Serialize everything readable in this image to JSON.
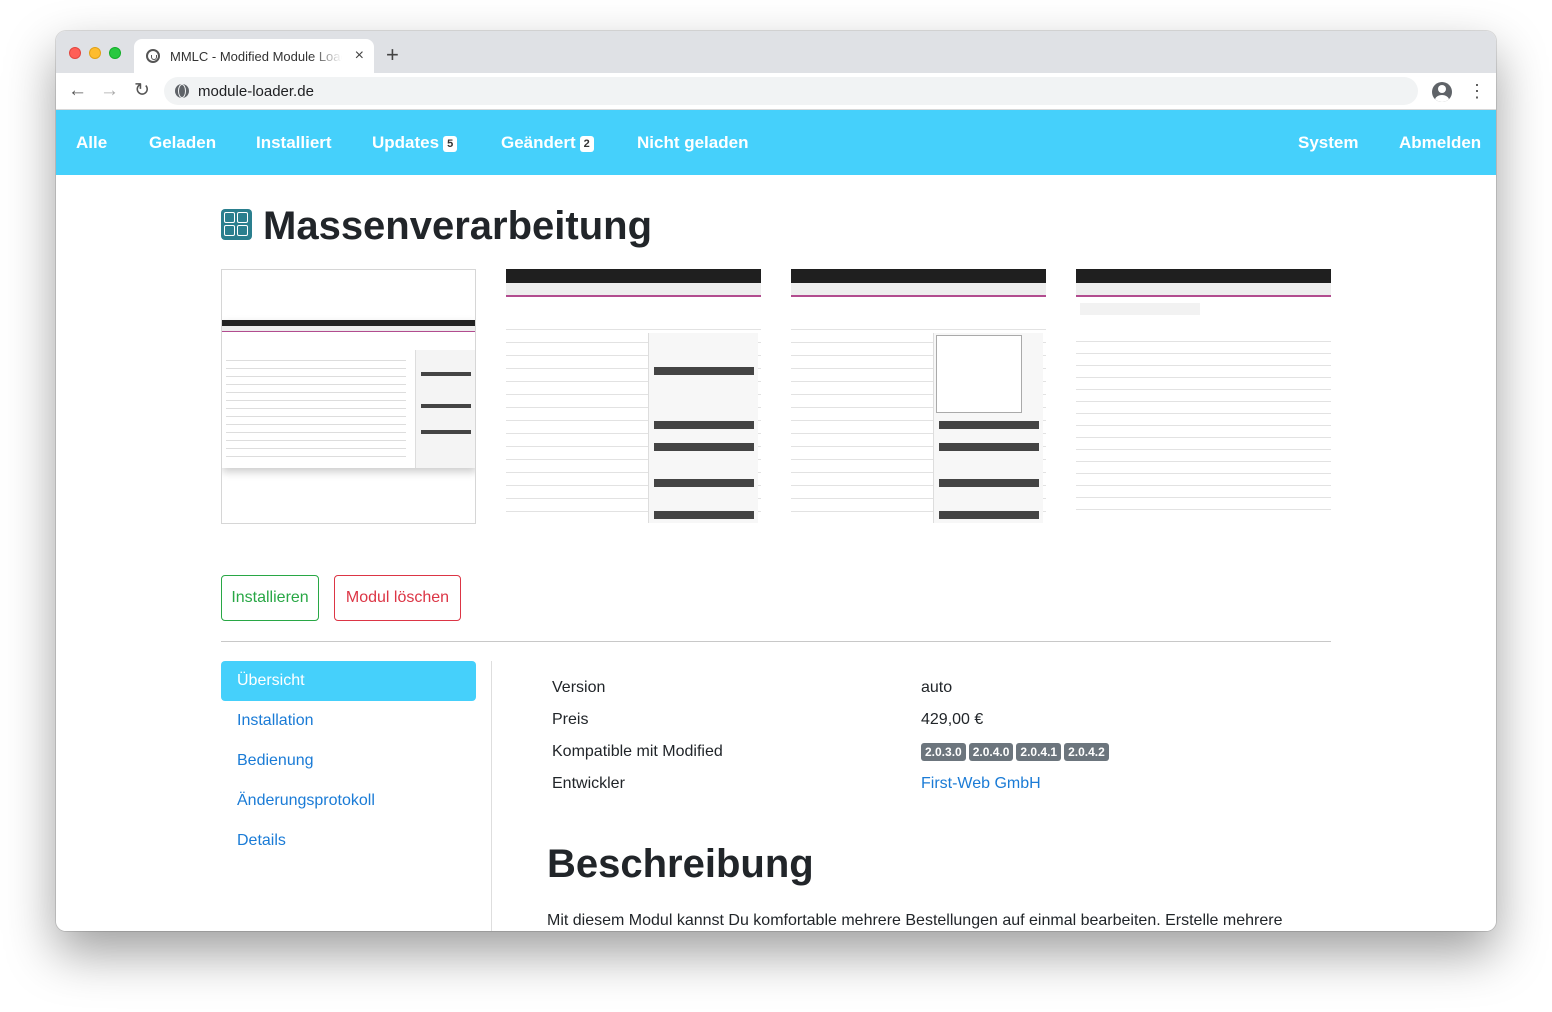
{
  "browser": {
    "tab_title": "MMLC - Modified Module Loader",
    "tab_close": "×",
    "new_tab": "+",
    "back": "←",
    "forward": "→",
    "reload": "↻",
    "url": "module-loader.de",
    "menu": "⋮"
  },
  "nav": {
    "items": [
      {
        "label": "Alle",
        "badge": ""
      },
      {
        "label": "Geladen",
        "badge": ""
      },
      {
        "label": "Installiert",
        "badge": ""
      },
      {
        "label": "Updates",
        "badge": "5"
      },
      {
        "label": "Geändert",
        "badge": "2"
      },
      {
        "label": "Nicht geladen",
        "badge": ""
      }
    ],
    "right": [
      {
        "label": "System"
      },
      {
        "label": "Abmelden"
      }
    ]
  },
  "module": {
    "title": "Massenverarbeitung",
    "icon": "checklist-icon",
    "screenshots": [
      {
        "name": "screenshot-overview"
      },
      {
        "name": "screenshot-actions"
      },
      {
        "name": "screenshot-status-dropdown"
      },
      {
        "name": "screenshot-customer-list"
      }
    ]
  },
  "actions": {
    "install": "Installieren",
    "delete": "Modul löschen"
  },
  "sidebar": {
    "items": [
      {
        "label": "Übersicht",
        "active": true
      },
      {
        "label": "Installation",
        "active": false
      },
      {
        "label": "Bedienung",
        "active": false
      },
      {
        "label": "Änderungsprotokoll",
        "active": false
      },
      {
        "label": "Details",
        "active": false
      }
    ]
  },
  "info": {
    "version_label": "Version",
    "version_value": "auto",
    "price_label": "Preis",
    "price_value": "429,00 €",
    "compat_label": "Kompatible mit Modified",
    "compat_versions": [
      "2.0.3.0",
      "2.0.4.0",
      "2.0.4.1",
      "2.0.4.2"
    ],
    "dev_label": "Entwickler",
    "dev_value": "First-Web GmbH"
  },
  "description": {
    "heading": "Beschreibung",
    "text": "Mit diesem Modul kannst Du komfortable mehrere Bestellungen auf einmal bearbeiten. Erstelle mehrere Rechnungen, Lieferscheine mit nur einem Klick und ändere den Bestellstatus von mehreren Bestellungen"
  },
  "colors": {
    "nav_bg": "#45d0fb",
    "success": "#28a745",
    "danger": "#dc3545",
    "link": "#1a7bd6",
    "badge": "#6c757d"
  }
}
